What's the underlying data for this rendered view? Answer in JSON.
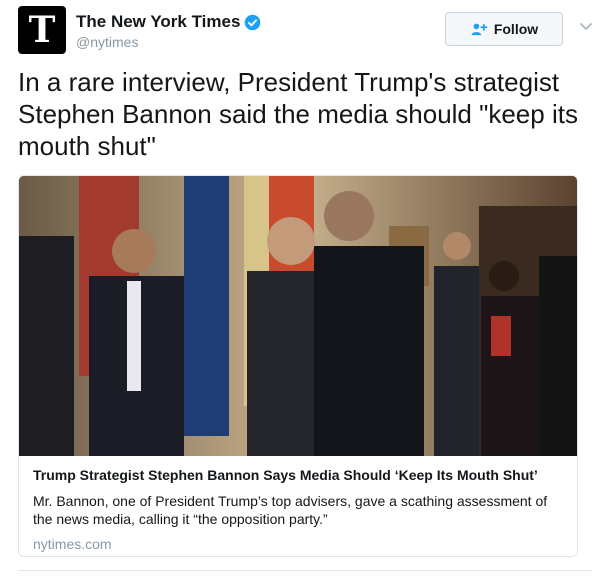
{
  "account": {
    "logo_glyph": "T",
    "display_name": "The New York Times",
    "handle": "@nytimes",
    "verified": true,
    "verified_icon": "verified-badge-icon"
  },
  "actions": {
    "follow_label": "Follow",
    "follow_icon": "add-person-icon",
    "more_icon": "chevron-down-icon"
  },
  "tweet": {
    "text": "In a rare interview, President Trump's strategist Stephen Bannon said the media should \"keep its mouth shut\""
  },
  "card": {
    "image_description": "photo-people-in-formal-room-with-flags",
    "title": "Trump Strategist Stephen Bannon Says Media Should ‘Keep Its Mouth Shut’",
    "description": "Mr. Bannon, one of President Trump’s top advisers, gave a scathing assessment of the news media, calling it “the opposition party.”",
    "domain": "nytimes.com"
  },
  "colors": {
    "brand_blue": "#1da1f2",
    "text_primary": "#14171a",
    "text_secondary": "#8899a6",
    "border": "#e1e8ed"
  }
}
